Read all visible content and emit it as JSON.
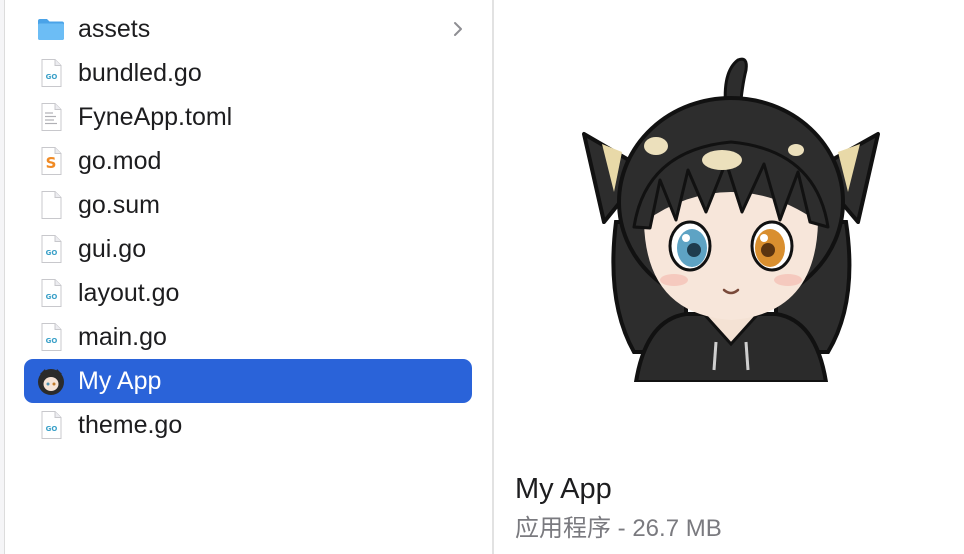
{
  "files": [
    {
      "name": "assets",
      "icon": "folder-icon",
      "expandable": true
    },
    {
      "name": "bundled.go",
      "icon": "go-file-icon"
    },
    {
      "name": "FyneApp.toml",
      "icon": "text-file-icon"
    },
    {
      "name": "go.mod",
      "icon": "swift-file-icon"
    },
    {
      "name": "go.sum",
      "icon": "blank-file-icon"
    },
    {
      "name": "gui.go",
      "icon": "go-file-icon"
    },
    {
      "name": "layout.go",
      "icon": "go-file-icon"
    },
    {
      "name": "main.go",
      "icon": "go-file-icon"
    },
    {
      "name": "My App",
      "icon": "app-icon",
      "selected": true
    },
    {
      "name": "theme.go",
      "icon": "go-file-icon"
    }
  ],
  "preview": {
    "title": "My App",
    "meta": "应用程序 - 26.7 MB",
    "image": "anime-cat-girl-app-icon"
  },
  "colors": {
    "selection": "#2a63d9",
    "folder": "#5ab0ef",
    "meta_text": "#7a7a7f"
  }
}
